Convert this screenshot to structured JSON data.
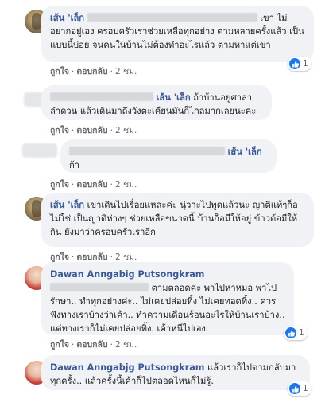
{
  "comments": [
    {
      "author": "เส้น 'เล็ก",
      "text_line1_tail": "เขา",
      "text_rest": "ไม่อยากอยู่เอง ครอบครัวเราช่วยเหลือทุกอย่าง ตามหลายครั้งแล้ว เป็นแบบนี้บ่อย จนคนในบ้านไม่ต้องทำอะไรแล้ว ตามหาแต่เขา",
      "actions": {
        "like": "ถูกใจ",
        "reply": "ตอบกลับ",
        "time": "2 ชม."
      },
      "reaction_count": "1"
    },
    {
      "author": "เส้น 'เล็ก",
      "text": "ถ้าบ้านอยู่ศาลาลำดวน แล้วเดินมาถึงวังตะเคียนมันก็ไกลมากเลยนะคะ",
      "actions": {
        "like": "ถูกใจ",
        "reply": "ตอบกลับ",
        "time": "2 ชม."
      }
    },
    {
      "author": "เส้น 'เล็ก",
      "text": "ก้า",
      "actions": {
        "like": "ถูกใจ",
        "reply": "ตอบกลับ",
        "time": "2 ชม."
      }
    },
    {
      "author": "เส้น 'เล็ก",
      "text": "เขาเดินไปเรื่อยแหละค่ะ นุ่วาะไปพูดแล้วนะ ญาติแท้ๆก็อไม่ใช่ เป็นญาติห่างๆ ช่วยเหลือขนาดนี้ บ้านก็อมีให้อยู่ ข้าวต้อมีให้กิน ยังมาว่าครอบครัวเราอีก",
      "actions": {
        "like": "ถูกใจ",
        "reply": "ตอบกลับ",
        "time": "2 ชม."
      }
    },
    {
      "author": "Dawan Anngabig Putsongkram",
      "text_line1_tail": "ตามตลอดค่ะ พาไปหาหมอ พาไปรักษา.. ทำทุกอย่างค่ะ.. ไม่เคยปล่อยทิ้ง ไม่เคยทอดทิ้ง..",
      "text_rest": "ควรฟังทางเราบ้างว่าเค้า.. ทำความเดือนร้อนอะไรให้บ้านเราบ้าง.. แต่ทางเราก็ไม่เคยปล่อยทิ้ง. เค้าหนีไปเอง.",
      "actions": {
        "like": "ถูกใจ",
        "reply": "ตอบกลับ",
        "time": "2 ชม."
      },
      "reaction_count": "1"
    },
    {
      "author": "Dawan Anngabjg Putsongkram",
      "text": "แล้วเราก็ไปตามกลับมาทุกครั้ง.. แล้วครั้งนี้เค้าก็ไปตลอดไหนก็ไม่รู้.",
      "actions": {
        "like": "ถูกใจ",
        "reply": "ตอบกลับ",
        "time": "2 ชม."
      },
      "reaction_count": "1"
    }
  ],
  "colors": {
    "author": "#385898",
    "bubble": "#f0f2f5",
    "meta": "#65676b",
    "like_blue": "#1877f2"
  },
  "icons": [
    "like-icon"
  ]
}
